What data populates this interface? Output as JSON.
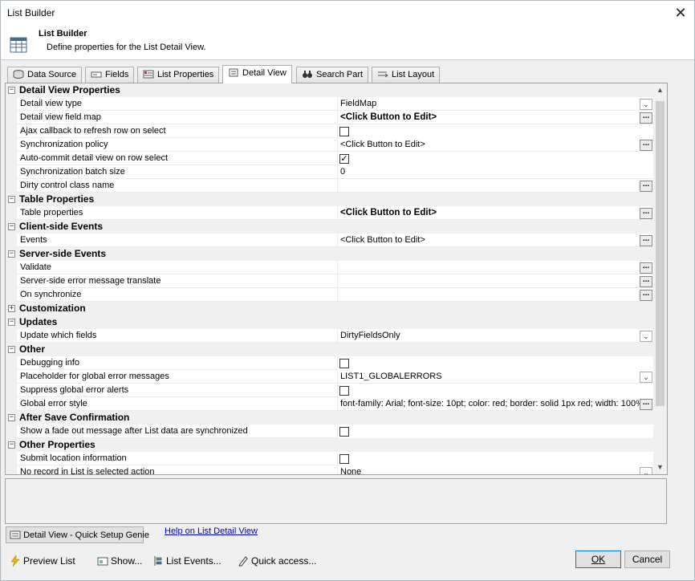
{
  "window": {
    "title": "List Builder"
  },
  "header": {
    "title": "List Builder",
    "subtitle": "Define properties for the List Detail View."
  },
  "tabs": [
    {
      "label": "Data Source",
      "icon": "database-icon"
    },
    {
      "label": "Fields",
      "icon": "field-icon"
    },
    {
      "label": "List Properties",
      "icon": "list-properties-icon"
    },
    {
      "label": "Detail View",
      "icon": "detail-view-icon"
    },
    {
      "label": "Search Part",
      "icon": "binoculars-icon"
    },
    {
      "label": "List Layout",
      "icon": "layout-icon"
    }
  ],
  "grid": {
    "rows": [
      {
        "kind": "cat",
        "label": "Detail View Properties",
        "expander": "−"
      },
      {
        "kind": "prop",
        "name": "Detail view type",
        "value": "FieldMap",
        "editor": "dropdown"
      },
      {
        "kind": "prop",
        "name": "Detail view field map",
        "value": "<Click Button to Edit>",
        "bold": true,
        "editor": "ellipsis"
      },
      {
        "kind": "prop",
        "name": "Ajax callback to refresh row on select",
        "value": "",
        "editor": "checkbox",
        "checked": false
      },
      {
        "kind": "prop",
        "name": "Synchronization policy",
        "value": "<Click Button to Edit>",
        "editor": "ellipsis"
      },
      {
        "kind": "prop",
        "name": "Auto-commit detail view on row select",
        "value": "",
        "editor": "checkbox",
        "checked": true
      },
      {
        "kind": "prop",
        "name": "Synchronization batch size",
        "value": "0",
        "editor": "text"
      },
      {
        "kind": "prop",
        "name": "Dirty control class name",
        "value": "",
        "editor": "ellipsis"
      },
      {
        "kind": "cat",
        "label": "Table Properties",
        "expander": "−"
      },
      {
        "kind": "prop",
        "name": "Table properties",
        "value": "<Click Button to Edit>",
        "bold": true,
        "editor": "ellipsis"
      },
      {
        "kind": "cat",
        "label": "Client-side Events",
        "expander": "−"
      },
      {
        "kind": "prop",
        "name": "Events",
        "value": "<Click Button to Edit>",
        "editor": "ellipsis"
      },
      {
        "kind": "cat",
        "label": "Server-side Events",
        "expander": "−"
      },
      {
        "kind": "prop",
        "name": "Validate",
        "value": "",
        "editor": "ellipsis"
      },
      {
        "kind": "prop",
        "name": "Server-side error message translate",
        "value": "",
        "editor": "ellipsis"
      },
      {
        "kind": "prop",
        "name": "On synchronize",
        "value": "",
        "editor": "ellipsis"
      },
      {
        "kind": "cat",
        "label": "Customization",
        "expander": "+"
      },
      {
        "kind": "cat",
        "label": "Updates",
        "expander": "−"
      },
      {
        "kind": "prop",
        "name": "Update which fields",
        "value": "DirtyFieldsOnly",
        "editor": "dropdown"
      },
      {
        "kind": "cat",
        "label": "Other",
        "expander": "−"
      },
      {
        "kind": "prop",
        "name": "Debugging info",
        "value": "",
        "editor": "checkbox",
        "checked": false
      },
      {
        "kind": "prop",
        "name": "Placeholder for global error messages",
        "value": "LIST1_GLOBALERRORS",
        "editor": "dropdown"
      },
      {
        "kind": "prop",
        "name": "Suppress global error alerts",
        "value": "",
        "editor": "checkbox",
        "checked": false
      },
      {
        "kind": "prop",
        "name": "Global error style",
        "value": "font-family: Arial; font-size: 10pt; color: red; border: solid 1px red; width: 100%;",
        "editor": "ellipsis"
      },
      {
        "kind": "cat",
        "label": "After Save Confirmation",
        "expander": "−"
      },
      {
        "kind": "prop",
        "name": "Show a fade out message after List data are synchronized",
        "value": "",
        "editor": "checkbox",
        "checked": false
      },
      {
        "kind": "cat",
        "label": "Other Properties",
        "expander": "−"
      },
      {
        "kind": "prop",
        "name": "Submit location information",
        "value": "",
        "editor": "checkbox",
        "checked": false
      },
      {
        "kind": "prop",
        "name": "No record in List is selected action",
        "value": "None",
        "editor": "dropdown"
      }
    ]
  },
  "genie_button": {
    "label": "Detail View - Quick Setup Genie"
  },
  "help_link": {
    "label": "Help on List Detail View"
  },
  "footer": {
    "preview": "Preview List",
    "show": "Show...",
    "events": "List Events...",
    "quick": "Quick access..."
  },
  "buttons": {
    "ok": "OK",
    "cancel": "Cancel"
  }
}
